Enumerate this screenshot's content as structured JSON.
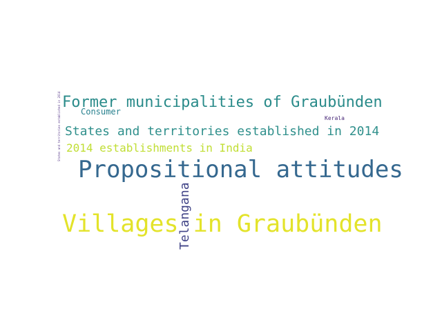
{
  "words": [
    {
      "text": "Villages in Graubünden",
      "color": "#e3e32a"
    },
    {
      "text": "Propositional attitudes",
      "color": "#35688f"
    },
    {
      "text": "Former municipalities of Graubünden",
      "color": "#2a8b8a"
    },
    {
      "text": "States and territories established in 2014",
      "color": "#30908c"
    },
    {
      "text": "2014 establishments in India",
      "color": "#c0de34"
    },
    {
      "text": "Telangana",
      "color": "#414487"
    },
    {
      "text": "Consumer",
      "color": "#27808e"
    },
    {
      "text": "Kerala",
      "color": "#482878"
    },
    {
      "text": "States and territories established in 2014",
      "color": "#5b3d8c"
    }
  ]
}
